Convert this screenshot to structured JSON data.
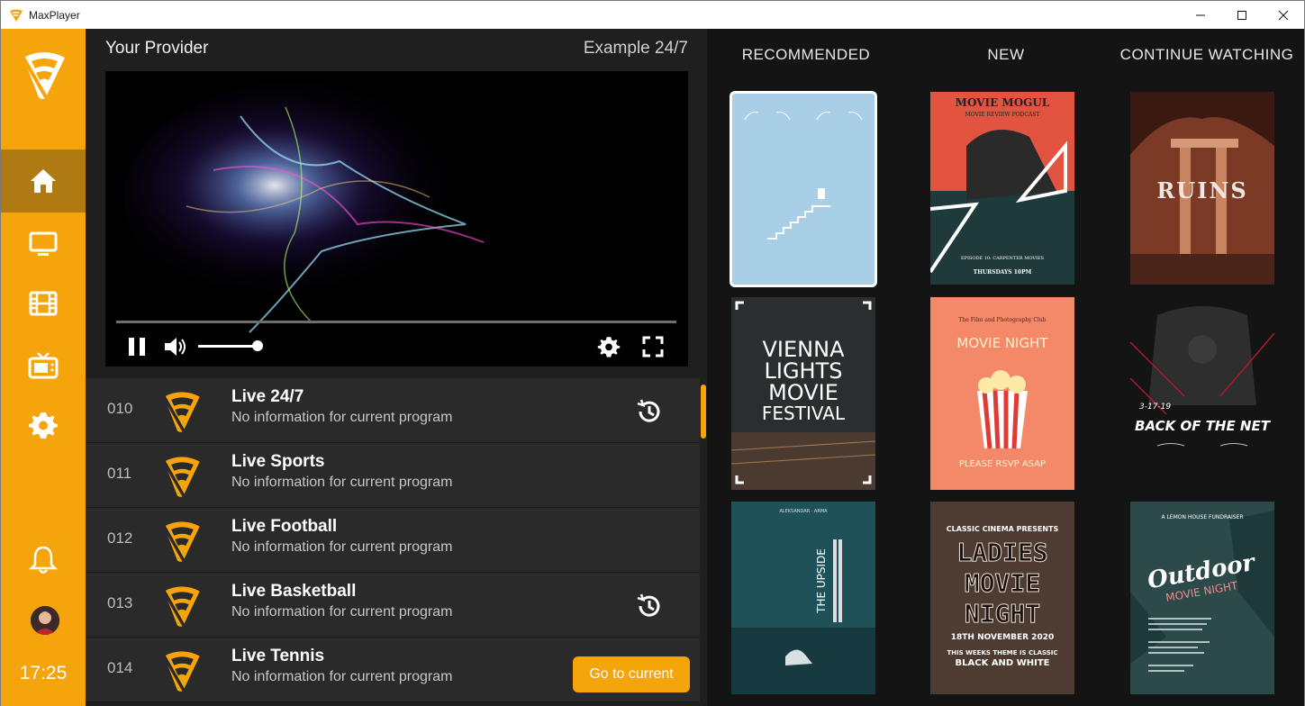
{
  "window": {
    "title": "MaxPlayer",
    "controls": [
      "minimize",
      "maximize",
      "close"
    ]
  },
  "sidebar": {
    "items": [
      {
        "name": "home",
        "active": true
      },
      {
        "name": "tv"
      },
      {
        "name": "movies"
      },
      {
        "name": "series"
      },
      {
        "name": "settings"
      }
    ],
    "clock": "17:25",
    "accent": "#f6a40c"
  },
  "player": {
    "provider_label": "Your Provider",
    "channel_label": "Example 24/7",
    "volume": 0.9
  },
  "channels": [
    {
      "number": "010",
      "title": "Live 24/7",
      "subtitle": "No information for current program",
      "history": true
    },
    {
      "number": "011",
      "title": "Live Sports",
      "subtitle": "No information for current program",
      "history": false
    },
    {
      "number": "012",
      "title": "Live Football",
      "subtitle": "No information for current program",
      "history": false
    },
    {
      "number": "013",
      "title": "Live Basketball",
      "subtitle": "No information for current program",
      "history": true
    },
    {
      "number": "014",
      "title": "Live Tennis",
      "subtitle": "No information for current program",
      "history": false
    }
  ],
  "go_current_label": "Go to current",
  "columns": {
    "recommended": "RECOMMENDED",
    "new": "NEW",
    "continue": "CONTINUE WATCHING"
  },
  "posters": {
    "p1": {
      "text": ""
    },
    "p2": {
      "line1": "MOVIE MOGUL",
      "line2": "MOVIE REVIEW PODCAST",
      "line3": "EPISODE 10: CARPENTER MOVIES",
      "line4": "THURSDAYS 10PM"
    },
    "p3": {
      "line1": "RUINS"
    },
    "p4": {
      "line1": "VIENNA",
      "line2": "LIGHTS",
      "line3": "MOVIE",
      "line4": "FESTIVAL"
    },
    "p5": {
      "line1": "The Film and Photography Club",
      "line2": "MOVIE NIGHT",
      "line3": "PLEASE RSVP ASAP"
    },
    "p6": {
      "line1": "3-17-19",
      "line2": "BACK OF THE NET"
    },
    "p7": {
      "line1": "ALEKSANDAR · ARMA",
      "line2": "THE UPSIDE"
    },
    "p8": {
      "line1": "CLASSIC CINEMA PRESENTS",
      "line2": "LADIES",
      "line3": "MOVIE",
      "line4": "NIGHT",
      "line5": "18TH NOVEMBER 2020",
      "line6": "THIS WEEKS THEME IS CLASSIC",
      "line7": "BLACK AND WHITE"
    },
    "p9": {
      "line1": "A LEMON HOUSE FUNDRAISER",
      "line2": "Outdoor",
      "line3": "MOVIE NIGHT"
    }
  }
}
